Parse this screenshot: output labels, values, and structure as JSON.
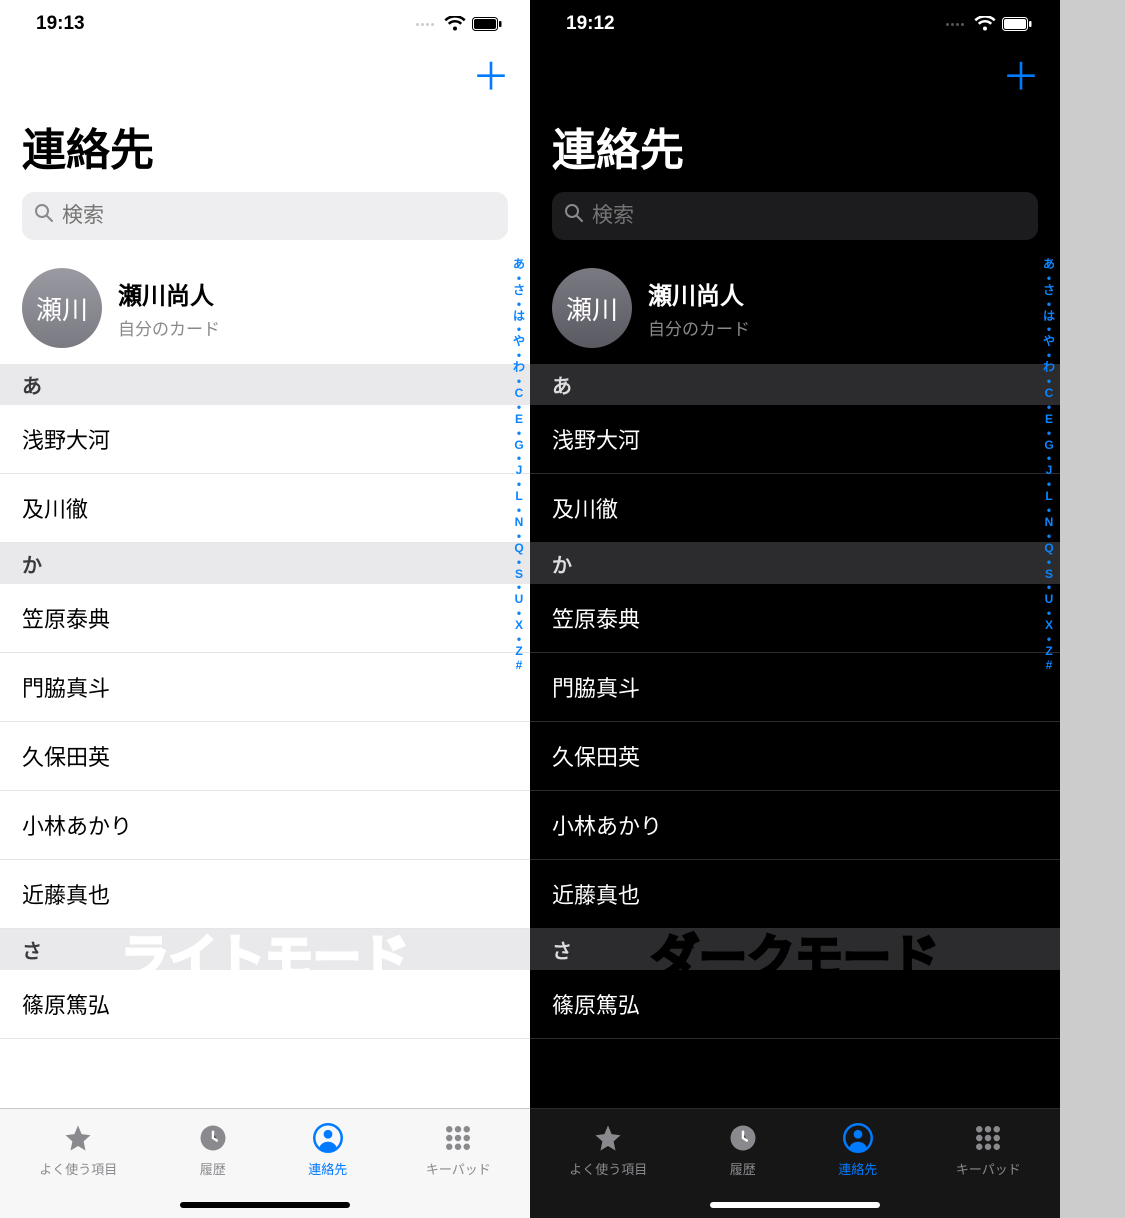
{
  "light": {
    "status": {
      "time": "19:13"
    },
    "title": "連絡先",
    "search_placeholder": "検索",
    "me": {
      "avatar_text": "瀬川",
      "name": "瀬川尚人",
      "subtitle": "自分のカード"
    },
    "sections": [
      {
        "letter": "あ",
        "rows": [
          "浅野大河",
          "及川徹"
        ]
      },
      {
        "letter": "か",
        "rows": [
          "笠原泰典",
          "門脇真斗",
          "久保田英",
          "小林あかり",
          "近藤真也"
        ]
      },
      {
        "letter": "さ",
        "rows": [
          "篠原篤弘"
        ]
      }
    ],
    "overlay": "ライトモード"
  },
  "dark": {
    "status": {
      "time": "19:12"
    },
    "title": "連絡先",
    "search_placeholder": "検索",
    "me": {
      "avatar_text": "瀬川",
      "name": "瀬川尚人",
      "subtitle": "自分のカード"
    },
    "sections": [
      {
        "letter": "あ",
        "rows": [
          "浅野大河",
          "及川徹"
        ]
      },
      {
        "letter": "か",
        "rows": [
          "笠原泰典",
          "門脇真斗",
          "久保田英",
          "小林あかり",
          "近藤真也"
        ]
      },
      {
        "letter": "さ",
        "rows": [
          "篠原篤弘"
        ]
      }
    ],
    "overlay": "ダークモード"
  },
  "index_items": [
    "あ",
    "•",
    "さ",
    "•",
    "は",
    "•",
    "や",
    "•",
    "わ",
    "•",
    "C",
    "•",
    "E",
    "•",
    "G",
    "•",
    "J",
    "•",
    "L",
    "•",
    "N",
    "•",
    "Q",
    "•",
    "S",
    "•",
    "U",
    "•",
    "X",
    "•",
    "Z",
    "#"
  ],
  "tabs": [
    {
      "id": "favorites",
      "label": "よく使う項目",
      "icon": "star"
    },
    {
      "id": "recents",
      "label": "履歴",
      "icon": "clock"
    },
    {
      "id": "contacts",
      "label": "連絡先",
      "icon": "person",
      "active": true
    },
    {
      "id": "keypad",
      "label": "キーパッド",
      "icon": "grid"
    }
  ]
}
